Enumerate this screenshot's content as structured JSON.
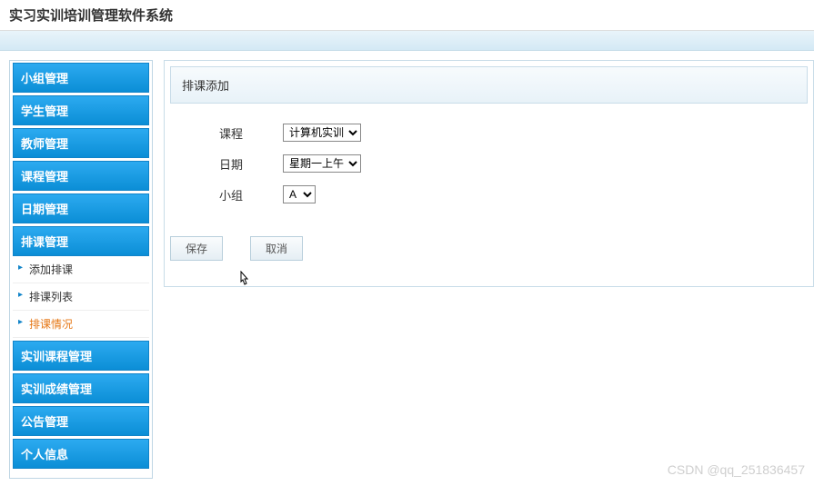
{
  "header": {
    "title": "实习实训培训管理软件系统"
  },
  "sidebar": {
    "items": [
      {
        "label": "小组管理"
      },
      {
        "label": "学生管理"
      },
      {
        "label": "教师管理"
      },
      {
        "label": "课程管理"
      },
      {
        "label": "日期管理"
      },
      {
        "label": "排课管理"
      }
    ],
    "sub": [
      {
        "label": "添加排课"
      },
      {
        "label": "排课列表"
      },
      {
        "label": "排课情况"
      }
    ],
    "items2": [
      {
        "label": "实训课程管理"
      },
      {
        "label": "实训成绩管理"
      },
      {
        "label": "公告管理"
      },
      {
        "label": "个人信息"
      }
    ]
  },
  "panel": {
    "title": "排课添加"
  },
  "form": {
    "course_label": "课程",
    "course_value": "计算机实训",
    "date_label": "日期",
    "date_value": "星期一上午",
    "group_label": "小组",
    "group_value": "A"
  },
  "buttons": {
    "save": "保存",
    "cancel": "取消"
  },
  "watermark": "CSDN @qq_251836457"
}
